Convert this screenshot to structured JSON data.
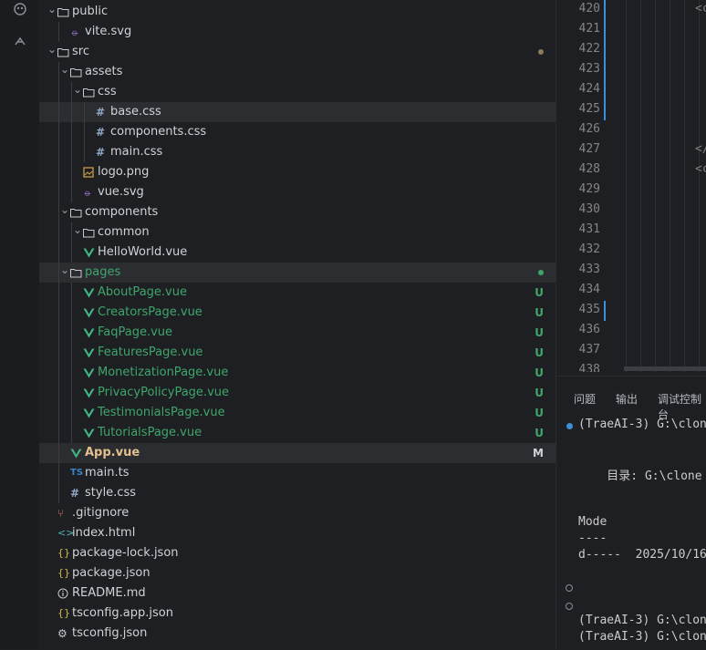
{
  "explorer": {
    "items": [
      {
        "label": "public",
        "kind": "folder",
        "depth": 0,
        "expanded": true
      },
      {
        "label": "vite.svg",
        "kind": "svg",
        "depth": 1
      },
      {
        "label": "src",
        "kind": "folder",
        "depth": 0,
        "expanded": true,
        "status": "dot-gray"
      },
      {
        "label": "assets",
        "kind": "folder",
        "depth": 1,
        "expanded": true
      },
      {
        "label": "css",
        "kind": "folder",
        "depth": 2,
        "expanded": true
      },
      {
        "label": "base.css",
        "kind": "css",
        "depth": 3,
        "selected": true
      },
      {
        "label": "components.css",
        "kind": "css",
        "depth": 3
      },
      {
        "label": "main.css",
        "kind": "css",
        "depth": 3
      },
      {
        "label": "logo.png",
        "kind": "png",
        "depth": 2
      },
      {
        "label": "vue.svg",
        "kind": "svg",
        "depth": 2
      },
      {
        "label": "components",
        "kind": "folder",
        "depth": 1,
        "expanded": true
      },
      {
        "label": "common",
        "kind": "folder",
        "depth": 2,
        "expanded": true
      },
      {
        "label": "HelloWorld.vue",
        "kind": "vue",
        "depth": 2
      },
      {
        "label": "pages",
        "kind": "folder",
        "depth": 1,
        "expanded": true,
        "state": "untracked",
        "status": "dot-green",
        "selected": true
      },
      {
        "label": "AboutPage.vue",
        "kind": "vue",
        "depth": 2,
        "state": "untracked",
        "badge": "U"
      },
      {
        "label": "CreatorsPage.vue",
        "kind": "vue",
        "depth": 2,
        "state": "untracked",
        "badge": "U"
      },
      {
        "label": "FaqPage.vue",
        "kind": "vue",
        "depth": 2,
        "state": "untracked",
        "badge": "U"
      },
      {
        "label": "FeaturesPage.vue",
        "kind": "vue",
        "depth": 2,
        "state": "untracked",
        "badge": "U"
      },
      {
        "label": "MonetizationPage.vue",
        "kind": "vue",
        "depth": 2,
        "state": "untracked",
        "badge": "U"
      },
      {
        "label": "PrivacyPolicyPage.vue",
        "kind": "vue",
        "depth": 2,
        "state": "untracked",
        "badge": "U"
      },
      {
        "label": "TestimonialsPage.vue",
        "kind": "vue",
        "depth": 2,
        "state": "untracked",
        "badge": "U"
      },
      {
        "label": "TutorialsPage.vue",
        "kind": "vue",
        "depth": 2,
        "state": "untracked",
        "badge": "U"
      },
      {
        "label": "App.vue",
        "kind": "vue",
        "depth": 1,
        "state": "modified",
        "badge": "M",
        "selected": true
      },
      {
        "label": "main.ts",
        "kind": "ts",
        "depth": 1
      },
      {
        "label": "style.css",
        "kind": "css",
        "depth": 1
      },
      {
        "label": ".gitignore",
        "kind": "git",
        "depth": 0
      },
      {
        "label": "index.html",
        "kind": "html",
        "depth": 0
      },
      {
        "label": "package-lock.json",
        "kind": "json",
        "depth": 0
      },
      {
        "label": "package.json",
        "kind": "json",
        "depth": 0
      },
      {
        "label": "README.md",
        "kind": "info",
        "depth": 0
      },
      {
        "label": "tsconfig.app.json",
        "kind": "json",
        "depth": 0
      },
      {
        "label": "tsconfig.json",
        "kind": "gear",
        "depth": 0
      }
    ]
  },
  "editor": {
    "line_numbers": [
      "420",
      "421",
      "422",
      "423",
      "424",
      "425",
      "426",
      "427",
      "428",
      "429",
      "430",
      "431",
      "432",
      "433",
      "434",
      "435",
      "436",
      "437",
      "438"
    ],
    "fragments": [
      {
        "text": "<c",
        "line": "420"
      },
      {
        "text": "</",
        "line": "427"
      },
      {
        "text": "<c",
        "line": "428"
      }
    ]
  },
  "panel": {
    "tabs": [
      "问题",
      "输出",
      "调试控制台"
    ],
    "terminal": [
      {
        "text": "(TraeAI-3) G:\\clon",
        "marker": "blue"
      },
      {
        "text": "    目录: G:\\clone"
      },
      {
        "text": "Mode"
      },
      {
        "text": "----"
      },
      {
        "text": "d-----  2025/10/16"
      },
      {
        "text": "",
        "marker": "hollow"
      },
      {
        "text": "",
        "marker": "hollow"
      },
      {
        "text": "(TraeAI-3) G:\\clon"
      },
      {
        "text": "(TraeAI-3) G:\\clon"
      }
    ]
  },
  "colors": {
    "untracked": "#3fa66b",
    "modified": "#e2c08d",
    "vue": "#41b883",
    "css": "#8fa8c8",
    "json": "#d7ba4a",
    "ts": "#3b82c4",
    "svg": "#a97ee0",
    "png": "#d4a74a",
    "accent": "#3f8fd8"
  },
  "icons": {
    "activity": [
      "copilot-icon",
      "debug-icon"
    ]
  }
}
